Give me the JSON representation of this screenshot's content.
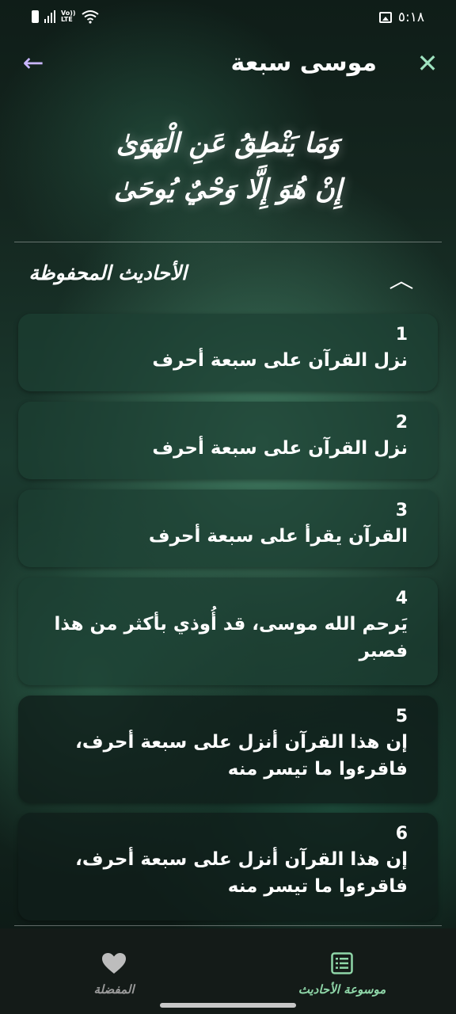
{
  "status_bar": {
    "time": "٥:١٨",
    "volte_top": "Vo))",
    "volte_bottom": "LTE"
  },
  "header": {
    "title": "موسى سبعة",
    "close_icon": "close-icon",
    "back_icon": "arrow-back-icon"
  },
  "verse": {
    "line1": "وَمَا يَنْطِقُ عَنِ الْهَوَىٰ",
    "line2": "إِنْ هُوَ إِلَّا وَحْيٌ يُوحَىٰ"
  },
  "section": {
    "title": "الأحاديث المحفوظة",
    "expanded": true
  },
  "hadiths": [
    {
      "number": "1",
      "text": "نزل القرآن على سبعة أحرف"
    },
    {
      "number": "2",
      "text": "نزل القرآن على سبعة أحرف"
    },
    {
      "number": "3",
      "text": "القرآن يقرأ على سبعة أحرف"
    },
    {
      "number": "4",
      "text": "يَرحم الله موسى، قد أُوذي بأكثر من هذا فصبر"
    },
    {
      "number": "5",
      "text": "إن هذا القرآن أنزل على سبعة أحرف، فاقرءوا ما تيسر منه"
    },
    {
      "number": "6",
      "text": "إن هذا القرآن أنزل على سبعة أحرف، فاقرءوا ما تيسر منه"
    }
  ],
  "bottom_nav": {
    "favorites_label": "المفضلة",
    "encyclopedia_label": "موسوعة الأحاديث",
    "active_color": "#8fd6a8",
    "inactive_color": "#9a9a9a"
  },
  "colors": {
    "accent_green": "#9fe3c0",
    "back_arrow": "#c9b6ff"
  }
}
